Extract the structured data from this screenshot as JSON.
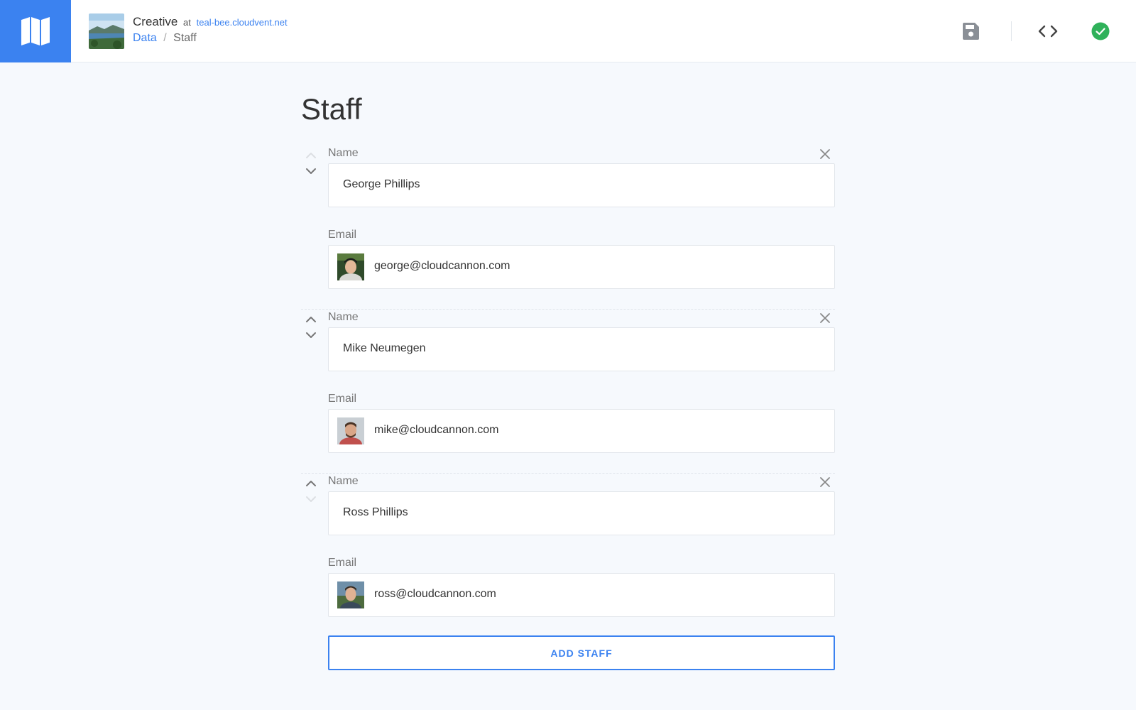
{
  "header": {
    "site_name": "Creative",
    "at_text": "at",
    "domain": "teal-bee.cloudvent.net",
    "breadcrumb": {
      "parent": "Data",
      "separator": "/",
      "current": "Staff"
    },
    "icons": {
      "logo": "map-icon",
      "save": "floppy-disk-icon",
      "source": "code-icon",
      "status": "check-circle-icon"
    },
    "colors": {
      "accent": "#3b82f0",
      "status": "#2fb15a"
    }
  },
  "page": {
    "title": "Staff"
  },
  "staff": [
    {
      "name_label": "Name",
      "name": "George Phillips",
      "email_label": "Email",
      "email": "george@cloudcannon.com"
    },
    {
      "name_label": "Name",
      "name": "Mike Neumegen",
      "email_label": "Email",
      "email": "mike@cloudcannon.com"
    },
    {
      "name_label": "Name",
      "name": "Ross Phillips",
      "email_label": "Email",
      "email": "ross@cloudcannon.com"
    }
  ],
  "actions": {
    "add_label": "ADD STAFF"
  }
}
